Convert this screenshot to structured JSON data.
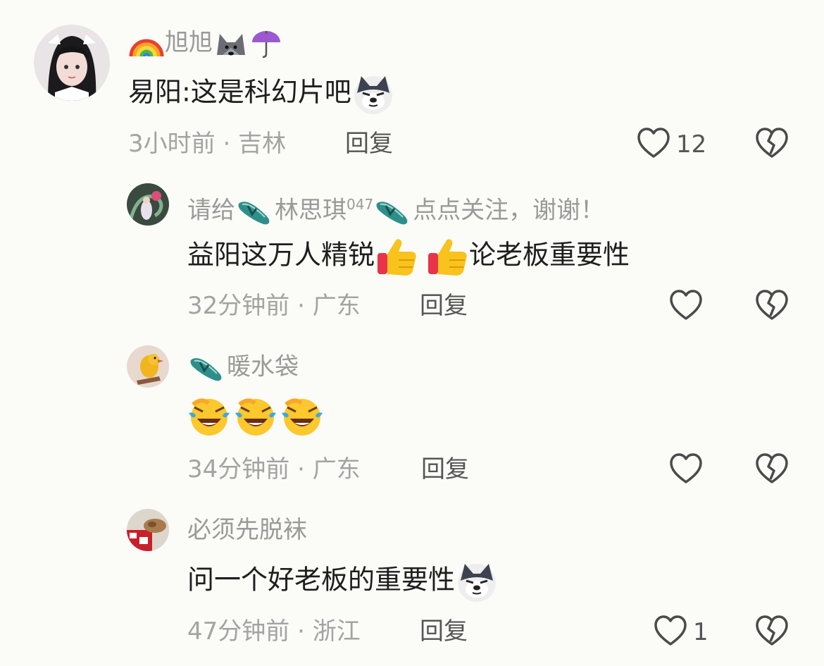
{
  "comments": [
    {
      "username": "旭旭",
      "content": "易阳:这是科幻片吧",
      "time": "3小时前",
      "location": "吉林",
      "reply_label": "回复",
      "likes": "12",
      "avatar_icon": "girl-avatar"
    },
    {
      "username_prefix": "请给",
      "username_middle": "林思琪",
      "username_sup": "047",
      "username_suffix": "点点关注，谢谢！",
      "content": "益阳这万人精锐",
      "content_suffix": "论老板重要性",
      "time": "32分钟前",
      "location": "广东",
      "reply_label": "回复",
      "likes": "",
      "avatar_icon": "dragon-avatar"
    },
    {
      "username": "暖水袋",
      "time": "34分钟前",
      "location": "广东",
      "reply_label": "回复",
      "likes": "",
      "avatar_icon": "bird-avatar"
    },
    {
      "username": "必须先脱袜",
      "content": "问一个好老板的重要性",
      "time": "47分钟前",
      "location": "浙江",
      "reply_label": "回复",
      "likes": "1",
      "avatar_icon": "food-avatar"
    }
  ],
  "separator": "·",
  "colors": {
    "background": "#fbfbf8",
    "text_primary": "#1e1e1e",
    "text_secondary": "#a3a3a3",
    "icon": "#4a4a4a"
  }
}
